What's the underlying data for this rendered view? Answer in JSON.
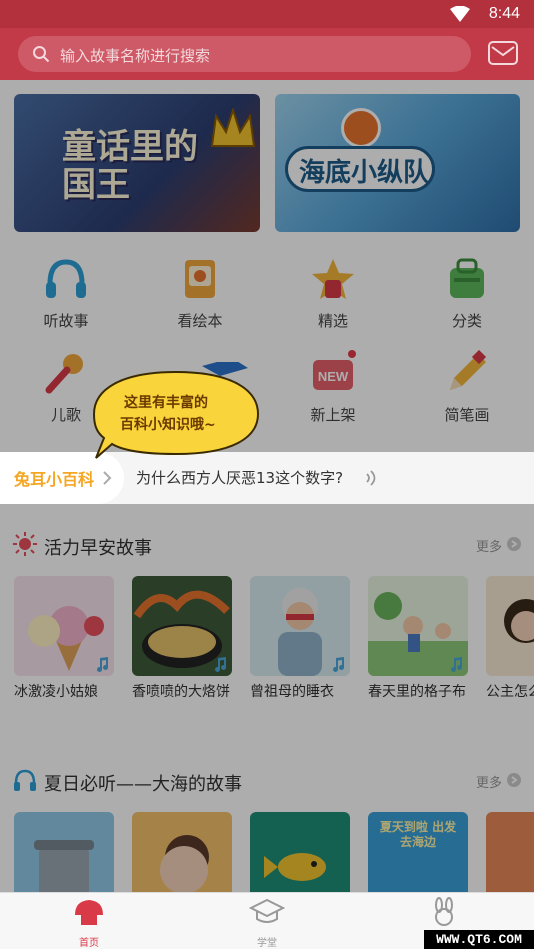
{
  "status": {
    "time": "8:44"
  },
  "search": {
    "placeholder": "输入故事名称进行搜索"
  },
  "banners": [
    {
      "title": "童话里的国王"
    },
    {
      "title": "海底小纵队"
    }
  ],
  "categories": [
    {
      "label": "听故事",
      "icon": "headphones-icon"
    },
    {
      "label": "看绘本",
      "icon": "book-icon"
    },
    {
      "label": "精选",
      "icon": "star-icon"
    },
    {
      "label": "分类",
      "icon": "bag-icon"
    },
    {
      "label": "儿歌",
      "icon": "microphone-icon"
    },
    {
      "label": "新上架",
      "icon": "new-icon"
    },
    {
      "label": "简笔画",
      "icon": "pencil-icon"
    }
  ],
  "tooltip": {
    "line1": "这里有丰富的",
    "line2": "百科小知识哦~"
  },
  "ticker": {
    "label": "兔耳小百科",
    "text": "为什么西方人厌恶13这个数字?"
  },
  "sections": [
    {
      "title": "活力早安故事",
      "more": "更多",
      "items": [
        {
          "title": "冰激凌小姑娘"
        },
        {
          "title": "香喷喷的大烙饼"
        },
        {
          "title": "曾祖母的睡衣"
        },
        {
          "title": "春天里的格子布"
        },
        {
          "title": "公主怎么屎"
        }
      ]
    },
    {
      "title": "夏日必听——大海的故事",
      "more": "更多",
      "items": [
        {
          "title": ""
        },
        {
          "title": ""
        },
        {
          "title": ""
        },
        {
          "title": "夏天到啦 出发去海边"
        },
        {
          "title": ""
        }
      ]
    }
  ],
  "tabs": [
    {
      "label": "首页",
      "active": true
    },
    {
      "label": "学堂",
      "active": false
    },
    {
      "label": "",
      "active": false
    }
  ],
  "watermark": "WWW.QT6.COM",
  "colors": {
    "brand": "#c23a48",
    "accent": "#f5a623"
  }
}
